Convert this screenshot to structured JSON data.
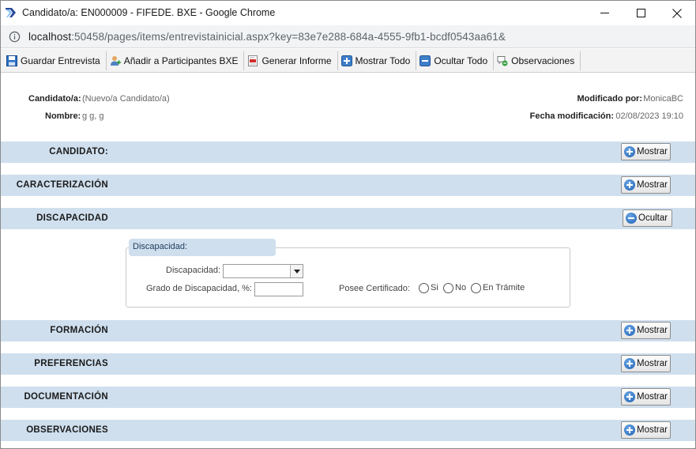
{
  "window": {
    "title": "Candidato/a: EN000009 - FIFEDE. BXE - Google Chrome",
    "url_host": "localhost",
    "url_rest": ":50458/pages/items/entrevistainicial.aspx?key=83e7e288-684a-4555-9fb1-bcdf0543aa61&"
  },
  "toolbar": {
    "items": [
      {
        "label": "Guardar Entrevista",
        "icon": "save-icon"
      },
      {
        "label": "Añadir a Participantes BXE",
        "icon": "add-user-icon"
      },
      {
        "label": "Generar Informe",
        "icon": "pdf-icon"
      },
      {
        "label": "Mostrar Todo",
        "icon": "plus-icon"
      },
      {
        "label": "Ocultar Todo",
        "icon": "minus-icon"
      },
      {
        "label": "Observaciones",
        "icon": "comments-icon"
      }
    ]
  },
  "header": {
    "candidato_label": "Candidato/a:",
    "candidato_value": "(Nuevo/a Candidato/a)",
    "nombre_label": "Nombre:",
    "nombre_value": "g g, g",
    "modificado_label": "Modificado por:",
    "modificado_value": "MonicaBC",
    "fecha_label": "Fecha modificación:",
    "fecha_value": "02/08/2023 19:10"
  },
  "sections": [
    {
      "title": "CANDIDATO:",
      "button": "Mostrar",
      "state": "collapsed"
    },
    {
      "title": "CARACTERIZACIÓN",
      "button": "Mostrar",
      "state": "collapsed"
    },
    {
      "title": "DISCAPACIDAD",
      "button": "Ocultar",
      "state": "expanded"
    },
    {
      "title": "FORMACIÓN",
      "button": "Mostrar",
      "state": "collapsed"
    },
    {
      "title": "PREFERENCIAS",
      "button": "Mostrar",
      "state": "collapsed"
    },
    {
      "title": "DOCUMENTACIÓN",
      "button": "Mostrar",
      "state": "collapsed"
    },
    {
      "title": "OBSERVACIONES",
      "button": "Mostrar",
      "state": "collapsed"
    }
  ],
  "discapacidad": {
    "legend": "Discapacidad:",
    "select_label": "Discapacidad:",
    "select_value": "",
    "grado_label": "Grado de Discapacidad, %:",
    "grado_value": "",
    "certificado_label": "Posee Certificado:",
    "options": [
      "Si",
      "No",
      "En Trámite"
    ]
  },
  "colors": {
    "band": "#cfdfee",
    "accent_blue": "#1f5fb0"
  }
}
